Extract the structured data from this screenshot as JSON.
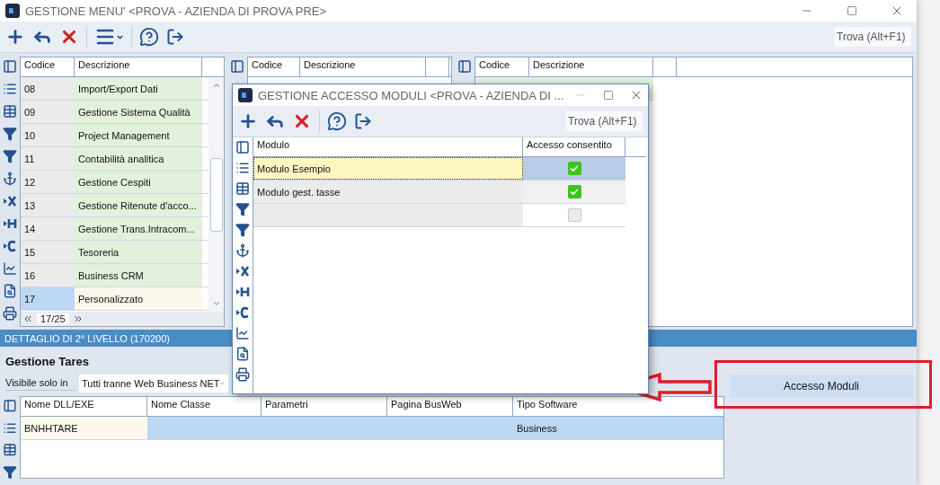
{
  "window": {
    "title": "GESTIONE MENU' <PROVA - AZIENDA DI PROVA PRE>"
  },
  "search": {
    "placeholder": "Trova (Alt+F1)"
  },
  "grids": [
    {
      "columns": [
        "Codice",
        "Descrizione"
      ],
      "navigator": "17/25",
      "rows": [
        {
          "cells": [
            "08",
            "Import/Export Dati"
          ],
          "selected": false
        },
        {
          "cells": [
            "09",
            "Gestione Sistema Qualità"
          ],
          "selected": false
        },
        {
          "cells": [
            "10",
            "Project Management"
          ],
          "selected": false
        },
        {
          "cells": [
            "11",
            "Contabilità analitica"
          ],
          "selected": false
        },
        {
          "cells": [
            "12",
            "Gestione Cespiti"
          ],
          "selected": false
        },
        {
          "cells": [
            "13",
            "Gestione Ritenute d'acco..."
          ],
          "selected": false
        },
        {
          "cells": [
            "14",
            "Gestione Trans.Intracom..."
          ],
          "selected": false
        },
        {
          "cells": [
            "15",
            "Tesoreria"
          ],
          "selected": false
        },
        {
          "cells": [
            "16",
            "Business CRM"
          ],
          "selected": false
        },
        {
          "cells": [
            "17",
            "Personalizzato"
          ],
          "selected": true
        }
      ]
    },
    {
      "columns": [
        "Codice",
        "Descrizione"
      ]
    },
    {
      "columns": [
        "Codice",
        "Descrizione"
      ]
    }
  ],
  "detail": {
    "header": "DETTAGLIO DI 2° LIVELLO (170200)",
    "title": "Gestione Tares",
    "visibility": {
      "label": "Visibile solo in",
      "value": "Tutti tranne Web Business NET"
    },
    "table": {
      "columns": [
        "Nome DLL/EXE",
        "Nome Classe",
        "Parametri",
        "Pagina BusWeb",
        "Tipo Software"
      ],
      "rows": [
        {
          "cells": [
            "BNHHTARE",
            null,
            null,
            null,
            "Business"
          ],
          "selected": true
        }
      ]
    },
    "button": "Accesso Moduli"
  },
  "dialog": {
    "title": "GESTIONE ACCESSO MODULI <PROVA - AZIENDA DI ...",
    "search": {
      "placeholder": "Trova (Alt+F1)"
    },
    "table": {
      "columns": [
        "Modulo",
        "Accesso consentito"
      ],
      "rows": [
        {
          "modulo": "Modulo Esempio",
          "checked": true,
          "selected": true
        },
        {
          "modulo": "Modulo gest. tasse",
          "checked": true,
          "selected": false
        },
        {
          "checked": false,
          "selected": false
        }
      ]
    }
  }
}
